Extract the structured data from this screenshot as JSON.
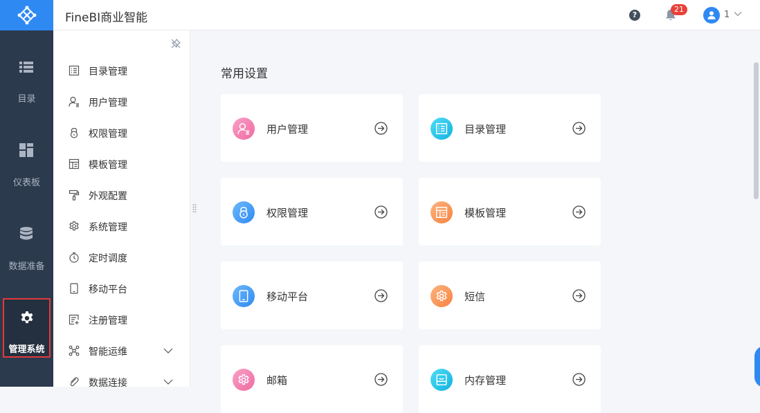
{
  "header": {
    "title": "FineBI商业智能",
    "help_icon": "?",
    "notification_count": "21",
    "user_name": "1"
  },
  "leftnav": [
    {
      "label": "目录",
      "icon": "list-icon"
    },
    {
      "label": "仪表板",
      "icon": "dashboard-icon"
    },
    {
      "label": "数据准备",
      "icon": "database-icon"
    },
    {
      "label": "管理系统",
      "icon": "gear-icon",
      "active": true
    }
  ],
  "submenu": [
    {
      "label": "目录管理",
      "icon": "catalog-icon"
    },
    {
      "label": "用户管理",
      "icon": "user-icon"
    },
    {
      "label": "权限管理",
      "icon": "lock-icon"
    },
    {
      "label": "模板管理",
      "icon": "template-icon"
    },
    {
      "label": "外观配置",
      "icon": "brush-icon"
    },
    {
      "label": "系统管理",
      "icon": "gear-icon"
    },
    {
      "label": "定时调度",
      "icon": "timer-icon"
    },
    {
      "label": "移动平台",
      "icon": "mobile-icon"
    },
    {
      "label": "注册管理",
      "icon": "register-icon"
    },
    {
      "label": "智能运维",
      "icon": "ops-icon",
      "expandable": true
    },
    {
      "label": "数据连接",
      "icon": "link-icon",
      "expandable": true
    }
  ],
  "main": {
    "section_title": "常用设置",
    "cards": [
      {
        "label": "用户管理",
        "icon": "user-icon",
        "color": "#f27fb0"
      },
      {
        "label": "目录管理",
        "icon": "catalog-icon",
        "color": "#1ec3e9"
      },
      {
        "label": "权限管理",
        "icon": "lock-icon",
        "color": "#3c9cf4"
      },
      {
        "label": "模板管理",
        "icon": "template-icon",
        "color": "#f9965a"
      },
      {
        "label": "移动平台",
        "icon": "mobile-icon",
        "color": "#3c9cf4"
      },
      {
        "label": "短信",
        "icon": "gear-icon",
        "color": "#f9965a"
      },
      {
        "label": "邮箱",
        "icon": "gear-icon",
        "color": "#f27fb0"
      },
      {
        "label": "内存管理",
        "icon": "memory-icon",
        "color": "#1ec3e9"
      }
    ]
  },
  "colors": {
    "accent": "#2f89f3",
    "nav_bg": "#2c3a4d",
    "active_outline": "#e43a3a",
    "badge": "#e8413a"
  }
}
